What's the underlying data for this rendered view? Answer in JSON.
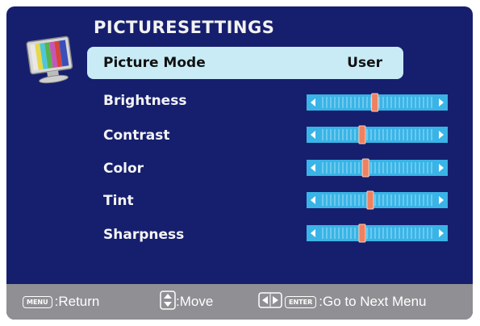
{
  "osd": {
    "title": "PICTURESETTINGS",
    "picture_mode": {
      "label": "Picture Mode",
      "value": "User"
    },
    "settings": [
      {
        "key": "brightness",
        "label": "Brightness",
        "level": 0.48
      },
      {
        "key": "contrast",
        "label": "Contrast",
        "level": 0.37
      },
      {
        "key": "color",
        "label": "Color",
        "level": 0.4
      },
      {
        "key": "tint",
        "label": "Tint",
        "level": 0.44
      },
      {
        "key": "sharpness",
        "label": "Sharpness",
        "level": 0.37
      }
    ]
  },
  "footer": {
    "menu_key": "MENU",
    "return_label": ":Return",
    "move_label": ":Move",
    "enter_key": "ENTER",
    "next_label": ":Go to Next Menu"
  },
  "colors": {
    "background": "#161f6e",
    "selected_row": "#c8ebf6",
    "slider_bar": "#3ab4e6",
    "slider_thumb": "#f08060",
    "footer": "#8f8f94"
  },
  "icons": [
    "monitor-icon",
    "left-arrow-icon",
    "right-arrow-icon",
    "up-down-arrow-icon",
    "left-right-arrow-icon"
  ]
}
